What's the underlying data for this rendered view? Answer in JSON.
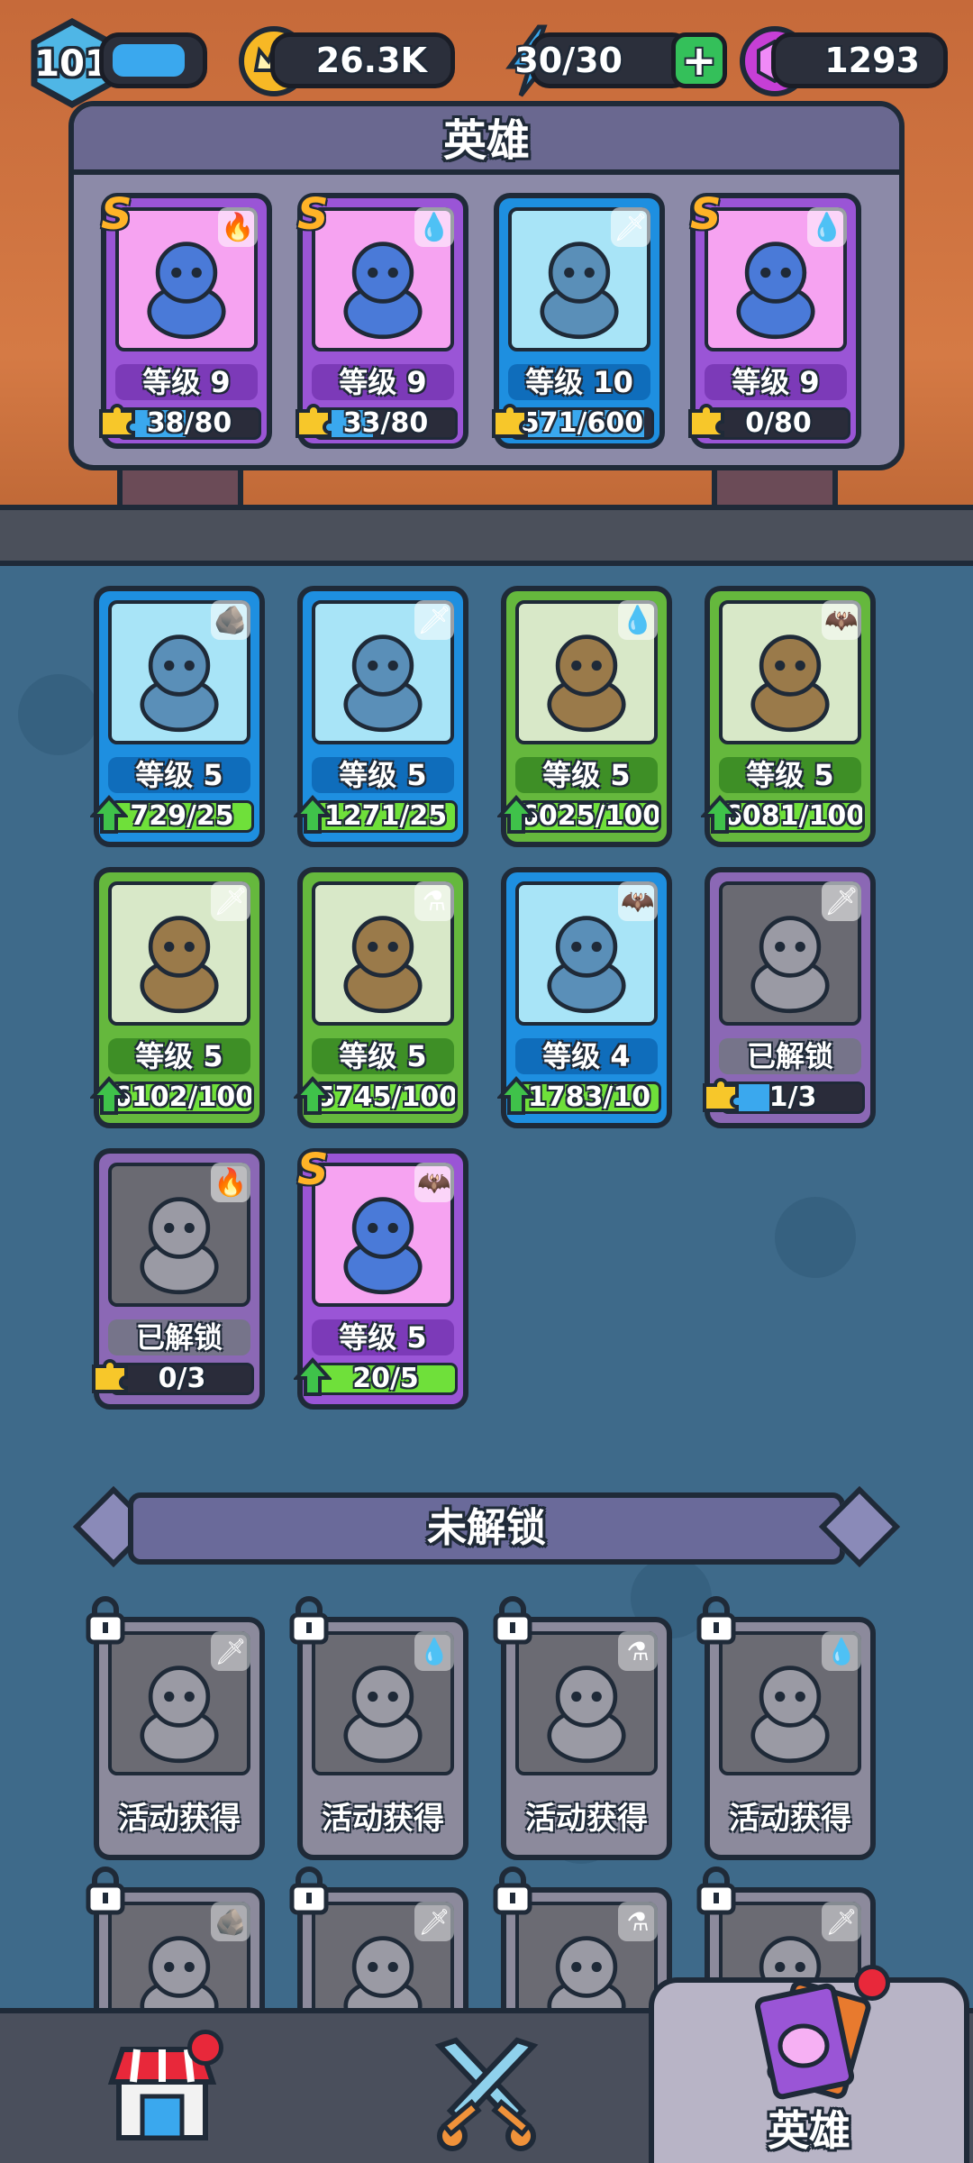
{
  "topbar": {
    "player_level": "101",
    "coins": "26.3K",
    "energy": "30/30",
    "gems": "1293",
    "xp_fraction": 0.8
  },
  "deck": {
    "title": "英雄",
    "cards": [
      {
        "rarity": "S",
        "color": "purple",
        "element": "fire-icon",
        "level": "等级 9",
        "progress": "38/80",
        "fraction": 0.475
      },
      {
        "rarity": "S",
        "color": "purple",
        "element": "water-drop-icon",
        "level": "等级 9",
        "progress": "33/80",
        "fraction": 0.41
      },
      {
        "rarity": "",
        "color": "blue",
        "element": "sword-icon",
        "level": "等级 10",
        "progress": "571/600",
        "fraction": 0.95
      },
      {
        "rarity": "S",
        "color": "purple",
        "element": "water-drop-icon",
        "level": "等级 9",
        "progress": "0/80",
        "fraction": 0.0
      }
    ]
  },
  "owned": {
    "cards": [
      {
        "rarity": "",
        "color": "blue",
        "element": "rock-icon",
        "level": "等级 5",
        "progress": "729/25",
        "fraction": 1.0,
        "upgrade": true
      },
      {
        "rarity": "",
        "color": "blue",
        "element": "sword-icon",
        "level": "等级 5",
        "progress": "1271/25",
        "fraction": 1.0,
        "upgrade": true
      },
      {
        "rarity": "",
        "color": "green",
        "element": "water-drop-icon",
        "level": "等级 5",
        "progress": "6025/100",
        "fraction": 1.0,
        "upgrade": true
      },
      {
        "rarity": "",
        "color": "green",
        "element": "bat-icon",
        "level": "等级 5",
        "progress": "6081/100",
        "fraction": 1.0,
        "upgrade": true
      },
      {
        "rarity": "",
        "color": "green",
        "element": "sword-icon",
        "level": "等级 5",
        "progress": "6102/100",
        "fraction": 1.0,
        "upgrade": true
      },
      {
        "rarity": "",
        "color": "green",
        "element": "potion-icon",
        "level": "等级 5",
        "progress": "5745/100",
        "fraction": 1.0,
        "upgrade": true
      },
      {
        "rarity": "",
        "color": "blue",
        "element": "bat-icon",
        "level": "等级 4",
        "progress": "1783/10",
        "fraction": 1.0,
        "upgrade": true
      },
      {
        "rarity": "",
        "color": "lockedpurple",
        "element": "sword-icon",
        "level": "已解锁",
        "progress": "1/3",
        "fraction": 0.33,
        "upgrade": false
      },
      {
        "rarity": "",
        "color": "lockedpurple",
        "element": "fire-icon",
        "level": "已解锁",
        "progress": "0/3",
        "fraction": 0.0,
        "upgrade": false
      },
      {
        "rarity": "S",
        "color": "purple",
        "element": "bat-icon",
        "level": "等级 5",
        "progress": "20/5",
        "fraction": 1.0,
        "upgrade": true
      }
    ]
  },
  "locked_section": {
    "title": "未解锁",
    "cards": [
      {
        "element": "sword-icon",
        "label": "活动获得"
      },
      {
        "element": "water-drop-icon",
        "label": "活动获得"
      },
      {
        "element": "potion-icon",
        "label": "活动获得"
      },
      {
        "element": "water-drop-icon",
        "label": "活动获得"
      },
      {
        "element": "rock-icon",
        "label": ""
      },
      {
        "element": "sword-icon",
        "label": ""
      },
      {
        "element": "potion-icon",
        "label": ""
      },
      {
        "element": "sword-icon",
        "label": ""
      }
    ]
  },
  "nav": {
    "shop_label": "",
    "battle_label": "",
    "heroes_label": "英雄"
  },
  "colors": {
    "card_purple": "#9a55d6",
    "card_blue": "#1e8fe0",
    "card_green": "#65b83d",
    "rarity_s": "#ffb327",
    "progress_blue": "#3aa8ee",
    "progress_green": "#6fe03a",
    "notification_red": "#e8283a"
  }
}
